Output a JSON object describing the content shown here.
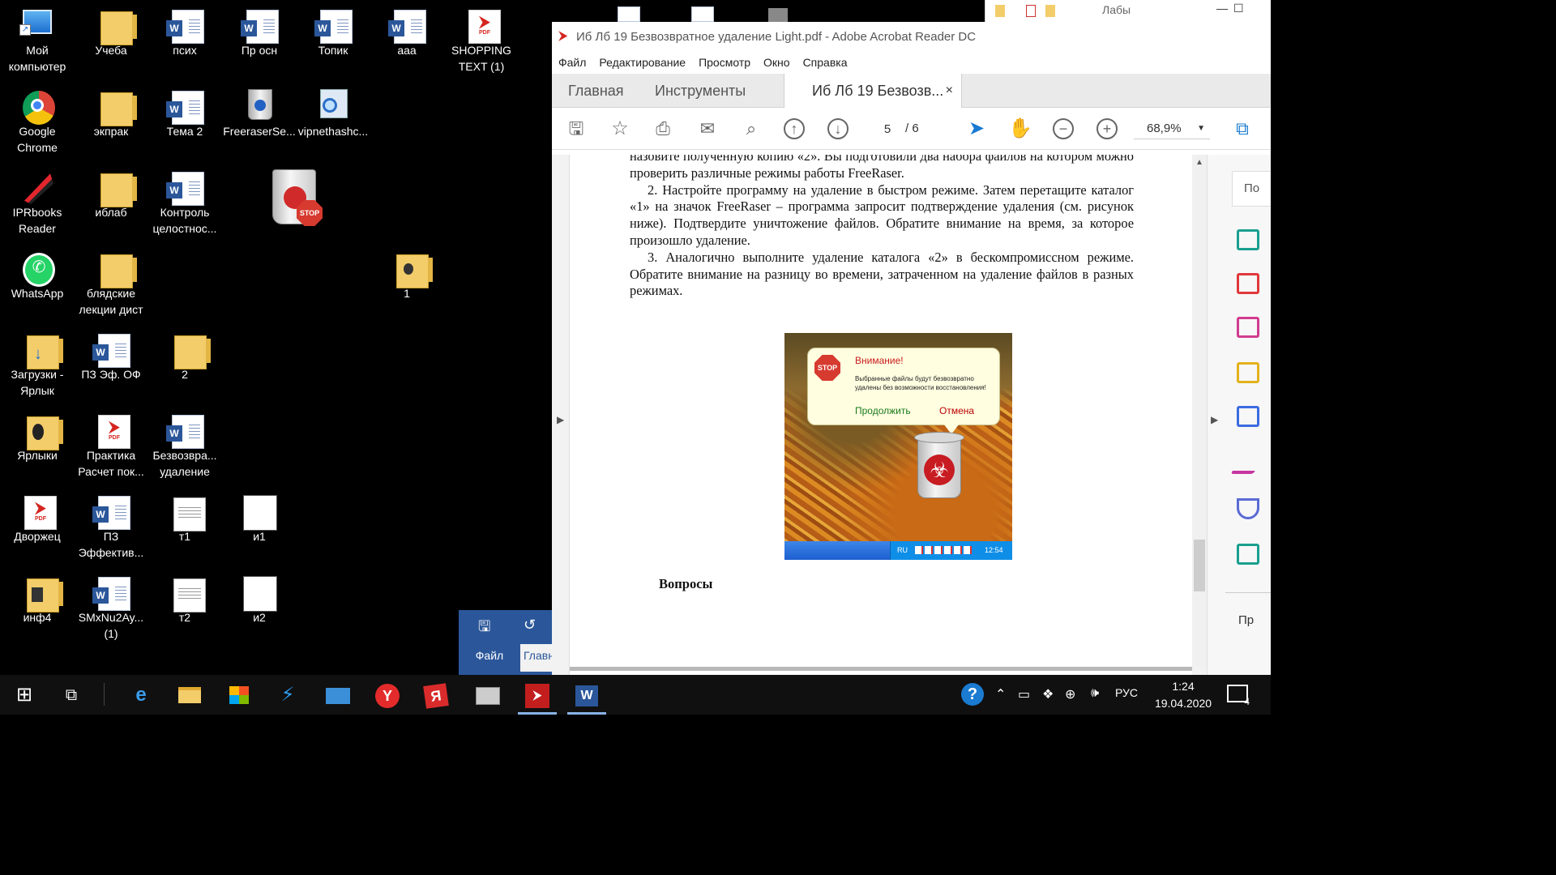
{
  "desktop": {
    "icons": [
      {
        "label": "Мой компьютер",
        "icon": "computer-icon"
      },
      {
        "label": "Учеба",
        "icon": "folder-icon"
      },
      {
        "label": "псих",
        "icon": "word-doc-icon"
      },
      {
        "label": "Пр осн",
        "icon": "word-doc-icon"
      },
      {
        "label": "Топик",
        "icon": "word-doc-icon"
      },
      {
        "label": "ааа",
        "icon": "word-doc-icon"
      },
      {
        "label": "SHOPPING TEXT (1)",
        "icon": "pdf-icon"
      },
      {
        "label": "Google Chrome",
        "icon": "chrome-icon"
      },
      {
        "label": "экпрак",
        "icon": "folder-icon"
      },
      {
        "label": "Тема 2",
        "icon": "word-doc-icon"
      },
      {
        "label": "FreeraserSe...",
        "icon": "recycle-icon"
      },
      {
        "label": "vipnethashc...",
        "icon": "search-app-icon"
      },
      {
        "label": "IPRbooks Reader",
        "icon": "iprbooks-icon"
      },
      {
        "label": "иблаб",
        "icon": "folder-icon"
      },
      {
        "label": "Контроль целостнос...",
        "icon": "word-doc-icon"
      },
      {
        "label": "WhatsApp",
        "icon": "whatsapp-icon"
      },
      {
        "label": "блядские лекции дист",
        "icon": "folder-icon"
      },
      {
        "label": "1",
        "icon": "folder-icon"
      },
      {
        "label": "Загрузки - Ярлык",
        "icon": "downloads-icon"
      },
      {
        "label": "ПЗ Эф. ОФ",
        "icon": "word-doc-icon"
      },
      {
        "label": "2",
        "icon": "folder-icon"
      },
      {
        "label": "Ярлыки",
        "icon": "folder-icon"
      },
      {
        "label": "Практика Расчет пок...",
        "icon": "pdf-icon"
      },
      {
        "label": "Безвозвра... удаление",
        "icon": "word-doc-icon"
      },
      {
        "label": "Дворжец",
        "icon": "pdf-icon"
      },
      {
        "label": "ПЗ Эффектив...",
        "icon": "word-doc-icon"
      },
      {
        "label": "т1",
        "icon": "text-doc-icon"
      },
      {
        "label": "и1",
        "icon": "blank-doc-icon"
      },
      {
        "label": "инф4",
        "icon": "folder-icon"
      },
      {
        "label": "SMxNu2Ay... (1)",
        "icon": "word-doc-icon"
      },
      {
        "label": "т2",
        "icon": "text-doc-icon"
      },
      {
        "label": "и2",
        "icon": "blank-doc-icon"
      }
    ]
  },
  "acrobat": {
    "title": "Иб Лб 19 Безвозвратное удаление Light.pdf - Adobe Acrobat Reader DC",
    "menu": [
      "Файл",
      "Редактирование",
      "Просмотр",
      "Окно",
      "Справка"
    ],
    "tabs": {
      "home": "Главная",
      "tools": "Инструменты",
      "doc": "Иб Лб 19 Безвозв...",
      "close": "×"
    },
    "toolbar": {
      "page_current": "5",
      "page_total": "/ 6",
      "zoom": "68,9%"
    },
    "document": {
      "para1": "назовите полученную копию «2». Вы подготовили два набора файлов на котором можно проверить различные режимы работы FreeRaser.",
      "para2": "2. Настройте программу на удаление в быстром режиме. Затем перетащите каталог «1» на значок FreeRaser – программа запросит подтверждение удаления (см. рисунок ниже). Подтвердите уничтожение файлов. Обратите внимание на время, за которое произошло удаление.",
      "para3": "3. Аналогично выполните удаление каталога «2» в бескомпромиссном режиме. Обратите внимание на разницу во времени, затраченном на удаление файлов в разных режимах.",
      "heading": "Вопросы",
      "figure": {
        "stop": "STOP",
        "title": "Внимание!",
        "message": "Выбранные файлы будут безвозвратно удалены без возможности восстановления!",
        "continue": "Продолжить",
        "cancel": "Отмена",
        "tray_lang": "RU",
        "tray_time": "12:54"
      }
    },
    "right_panel": {
      "search_hint": "По",
      "bottom_label": "Пр"
    }
  },
  "word_fragment": {
    "file": "Файл",
    "home": "Главн"
  },
  "explorer_fragment": {
    "title": "Лабы"
  },
  "taskbar": {
    "time": "1:24",
    "date": "19.04.2020",
    "lang": "РУС",
    "notifications": "4"
  }
}
